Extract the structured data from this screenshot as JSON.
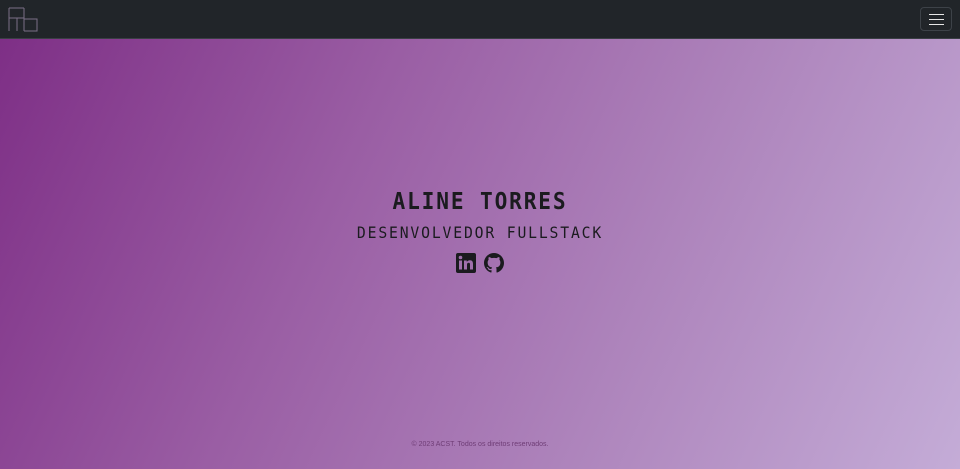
{
  "navbar": {
    "logo_icon": "monogram-logo-icon",
    "toggler_icon": "hamburger-menu-icon"
  },
  "hero": {
    "name": "ALINE TORRES",
    "role": "DESENVOLVEDOR FULLSTACK"
  },
  "socials": [
    {
      "icon": "linkedin-icon"
    },
    {
      "icon": "github-icon"
    }
  ],
  "footer": {
    "copyright": "© 2023 ACST. Todos os direitos reservados."
  },
  "colors": {
    "navbar_bg": "#212529",
    "gradient_start": "#7e2f86",
    "gradient_end": "#c4acd7",
    "text_dark": "#1b1b1f"
  }
}
